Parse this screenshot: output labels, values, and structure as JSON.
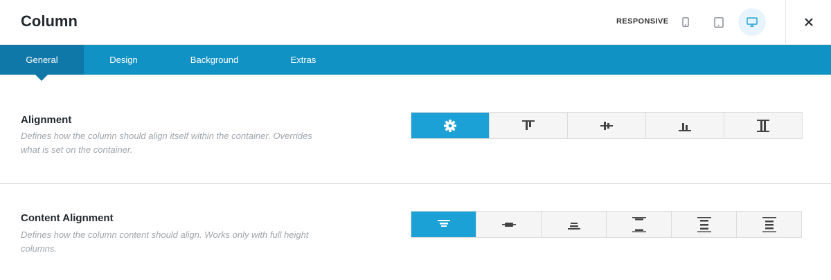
{
  "header": {
    "title": "Column",
    "responsive_label": "RESPONSIVE",
    "devices": [
      {
        "name": "mobile",
        "icon": "mobile-icon",
        "active": false
      },
      {
        "name": "tablet",
        "icon": "tablet-icon",
        "active": false
      },
      {
        "name": "desktop",
        "icon": "desktop-icon",
        "active": true
      }
    ],
    "close_icon": "close-icon"
  },
  "tabs": [
    {
      "label": "General",
      "active": true
    },
    {
      "label": "Design",
      "active": false
    },
    {
      "label": "Background",
      "active": false
    },
    {
      "label": "Extras",
      "active": false
    }
  ],
  "alignment": {
    "title": "Alignment",
    "description": "Defines how the column should align itself within the container. Overrides what is set on the container.",
    "options": [
      {
        "icon": "gear-icon",
        "active": true
      },
      {
        "icon": "align-top-icon",
        "active": false
      },
      {
        "icon": "align-center-icon",
        "active": false
      },
      {
        "icon": "align-bottom-icon",
        "active": false
      },
      {
        "icon": "align-stretch-icon",
        "active": false
      }
    ]
  },
  "content_alignment": {
    "title": "Content Alignment",
    "description": "Defines how the column content should align. Works only with full height columns.",
    "options": [
      {
        "icon": "content-top-icon",
        "active": true
      },
      {
        "icon": "content-center-icon",
        "active": false
      },
      {
        "icon": "content-bottom-icon",
        "active": false
      },
      {
        "icon": "content-space-between-icon",
        "active": false
      },
      {
        "icon": "content-space-around-icon",
        "active": false
      },
      {
        "icon": "content-space-evenly-icon",
        "active": false
      }
    ]
  },
  "colors": {
    "accent": "#1ba1d5",
    "tab_bar": "#1192c4",
    "tab_active": "#0f78a8"
  }
}
